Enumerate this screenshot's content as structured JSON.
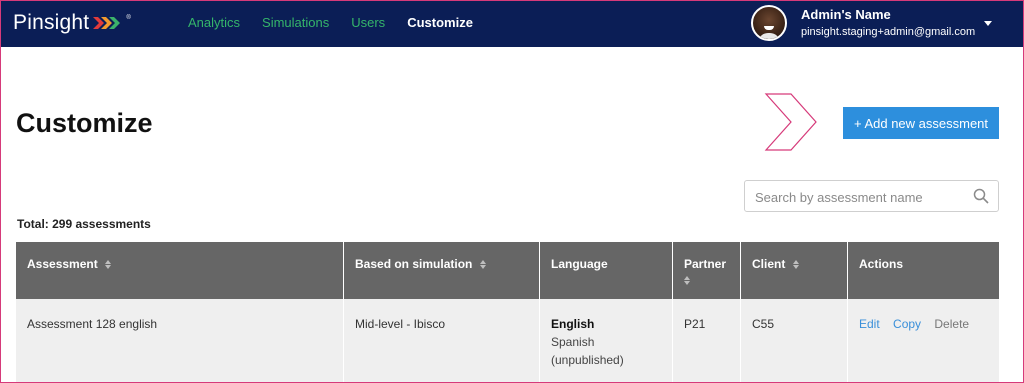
{
  "app": {
    "logo": "Pinsight",
    "logo_mark": "®"
  },
  "nav": {
    "links": [
      "Analytics",
      "Simulations",
      "Users",
      "Customize"
    ],
    "active": "Customize"
  },
  "user": {
    "name": "Admin's Name",
    "email": "pinsight.staging+admin@gmail.com"
  },
  "page": {
    "title": "Customize",
    "add_button": "+ Add new assessment",
    "search_placeholder": "Search by assessment name",
    "total": "Total: 299 assessments"
  },
  "table": {
    "headers": [
      "Assessment",
      "Based on simulation",
      "Language",
      "Partner",
      "Client",
      "Actions"
    ],
    "rows": [
      {
        "assessment": "Assessment 128 english",
        "simulation": "Mid-level - Ibisco",
        "language_primary": "English",
        "language_secondary": "Spanish",
        "language_note": "(unpublished)",
        "partner": "P21",
        "client": "C55",
        "actions": [
          "Edit",
          "Copy",
          "Delete"
        ]
      }
    ]
  },
  "colors": {
    "navbar": "#0b1e56",
    "nav_link": "#35b56a",
    "primary_button": "#2d8fdd",
    "table_header": "#666666",
    "row_bg": "#efefef",
    "accent_chevron": "#d63a7a"
  },
  "icons": [
    "logo-chevrons-icon",
    "chevron-down-icon",
    "decorative-chevron-icon",
    "search-icon",
    "sort-icon"
  ]
}
